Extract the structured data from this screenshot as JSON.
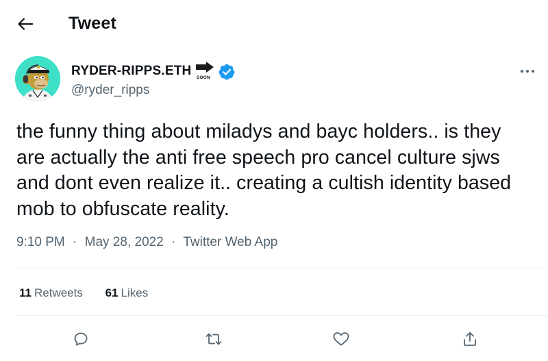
{
  "header": {
    "title": "Tweet",
    "back_icon": "arrow-left-icon"
  },
  "author": {
    "name": "RYDER-RIPPS.ETH",
    "badge_text": "SOON",
    "handle": "@ryder_ripps",
    "verified": true,
    "avatar_bg": "#3ee0c8"
  },
  "tweet": {
    "text": "the funny thing about miladys and bayc holders.. is they are actually the anti free speech pro cancel culture sjws and dont even realize it.. creating a cultish identity based mob to obfuscate reality.",
    "time": "9:10 PM",
    "separator": "·",
    "date": "May 28, 2022",
    "source": "Twitter Web App"
  },
  "stats": {
    "retweets_count": "11",
    "retweets_label": "Retweets",
    "likes_count": "61",
    "likes_label": "Likes"
  },
  "actions": [
    "reply-icon",
    "retweet-icon",
    "like-icon",
    "share-icon"
  ],
  "colors": {
    "text": "#0f1419",
    "secondary": "#536471",
    "verified": "#1d9bf0",
    "divider": "#eff3f4"
  }
}
